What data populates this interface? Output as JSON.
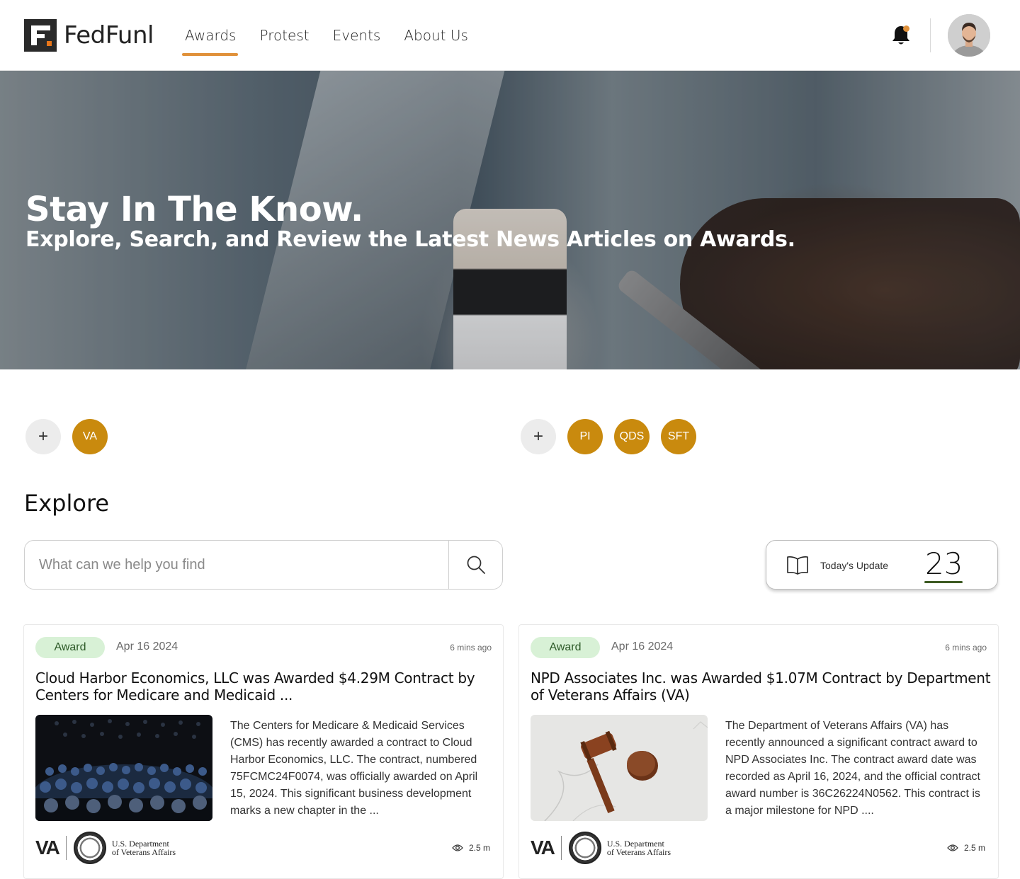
{
  "header": {
    "logo_text": "FedFunl",
    "nav": [
      {
        "label": "Awards",
        "active": true
      },
      {
        "label": "Protest",
        "active": false
      },
      {
        "label": "Events",
        "active": false
      },
      {
        "label": "About Us",
        "active": false
      }
    ],
    "accent_color": "#e0913a"
  },
  "hero": {
    "title": "Stay In The Know.",
    "subtitle": "Explore, Search, and Review the Latest News Articles on Awards."
  },
  "filters": {
    "left_tags": [
      "VA"
    ],
    "right_tags": [
      "PI",
      "QDS",
      "SFT"
    ],
    "add_symbol": "+",
    "tag_color": "#c98a0e"
  },
  "explore": {
    "title": "Explore",
    "search_placeholder": "What can we help you find",
    "search_value": "",
    "todays_update_label": "Today's Update",
    "todays_update_count": "23"
  },
  "articles": [
    {
      "badge": "Award",
      "date": "Apr 16 2024",
      "time_ago": "6 mins ago",
      "title": "Cloud Harbor Economics, LLC was Awarded $4.29M Contract by Centers for Medicare and Medicaid ...",
      "body": "The Centers for Medicare & Medicaid Services (CMS) has recently awarded a contract to Cloud Harbor Economics, LLC. The contract, numbered 75FCMC24F0074, was officially awarded on April 15, 2024. This significant business development marks a new chapter in the ...",
      "agency_abbr": "VA",
      "agency_line1": "U.S. Department",
      "agency_line2": "of Veterans Affairs",
      "views": "2.5 m",
      "image": "conference-audience-photo"
    },
    {
      "badge": "Award",
      "date": "Apr 16 2024",
      "time_ago": "6 mins ago",
      "title": "NPD Associates Inc. was Awarded $1.07M Contract by Department of Veterans Affairs (VA)",
      "body": "The Department of Veterans Affairs (VA) has recently announced a significant contract award to NPD Associates Inc. The contract award date was recorded as April 16, 2024, and the official contract award number is 36C26224N0562. This contract is a major milestone for NPD ....",
      "agency_abbr": "VA",
      "agency_line1": "U.S. Department",
      "agency_line2": "of Veterans Affairs",
      "views": "2.5 m",
      "image": "gavel-photo"
    }
  ]
}
